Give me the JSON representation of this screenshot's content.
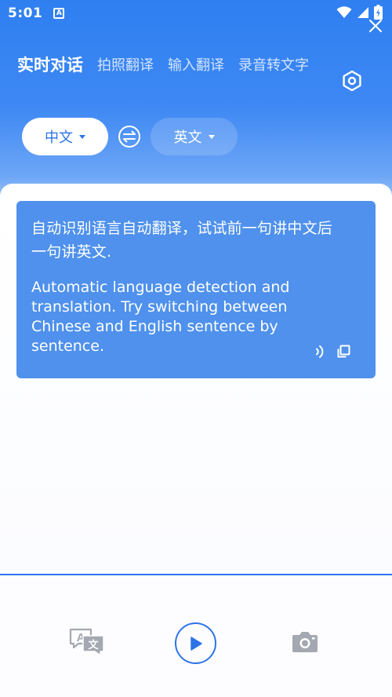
{
  "status_bar": {
    "time": "5:01",
    "notification_icon": "a-badge-icon",
    "icons": [
      "wifi-icon",
      "signal-icon",
      "battery-icon"
    ]
  },
  "tabs": [
    {
      "label": "实时对话",
      "active": true
    },
    {
      "label": "拍照翻译",
      "active": false
    },
    {
      "label": "输入翻译",
      "active": false
    },
    {
      "label": "录音转文字",
      "active": false
    }
  ],
  "settings": {
    "icon": "hexagon-settings-icon"
  },
  "languages": {
    "source": "中文",
    "target": "英文",
    "swap_icon": "swap-arrows-icon"
  },
  "hint_card": {
    "chinese_text": "自动识别语言自动翻译，试试前一句讲中文后一句讲英文.",
    "english_text": "Automatic language detection and translation. Try switching between Chinese and English sentence by sentence.",
    "close_icon": "close-icon",
    "speak_icon": "speaker-icon",
    "copy_icon": "copy-icon"
  },
  "bottom_bar": {
    "translate_icon": "translate-icon",
    "play_icon": "play-icon",
    "camera_icon": "camera-icon"
  },
  "colors": {
    "accent": "#2c73e8",
    "header_top": "#2f7ff1",
    "card": "#4f91ec"
  }
}
